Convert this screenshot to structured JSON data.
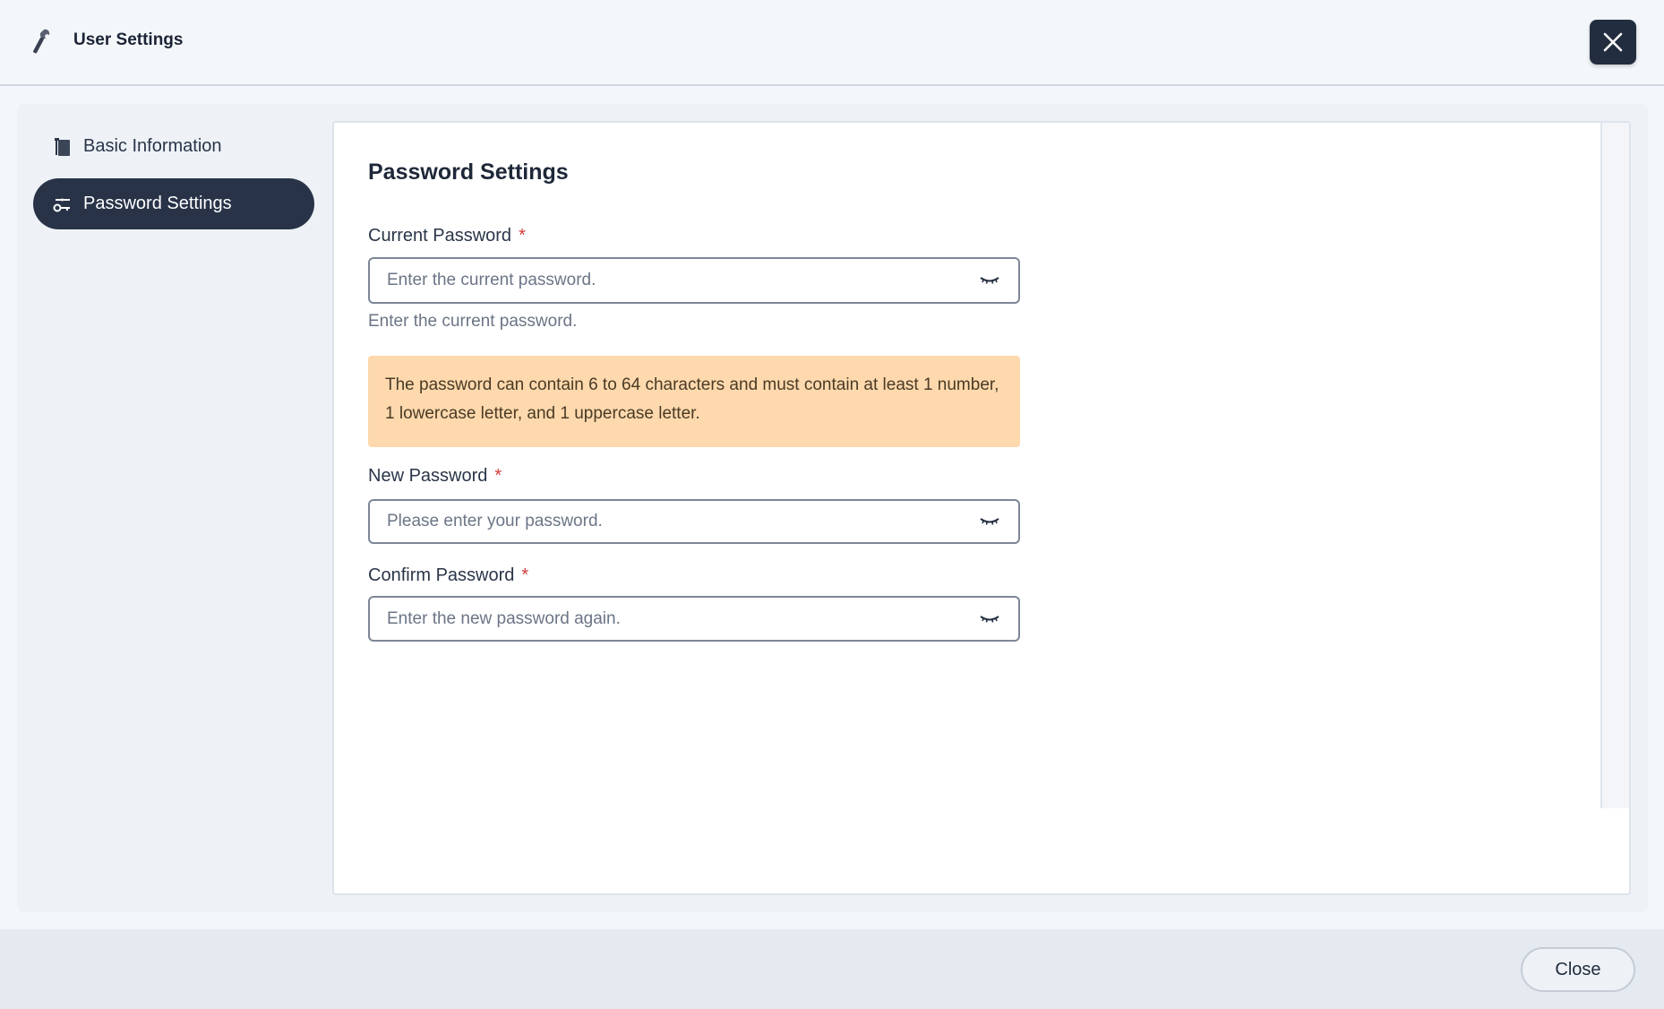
{
  "header": {
    "title": "User Settings",
    "app_icon": "wrench-icon",
    "close_icon": "close-icon"
  },
  "sidebar": {
    "items": [
      {
        "label": "Basic Information",
        "icon": "document-icon",
        "active": false
      },
      {
        "label": "Password Settings",
        "icon": "key-icon",
        "active": true
      }
    ]
  },
  "main": {
    "title": "Password Settings",
    "current_password": {
      "label": "Current Password",
      "required_mark": "*",
      "placeholder": "Enter the current password.",
      "value": "",
      "hint": "Enter the current password."
    },
    "notice": "The password can contain 6 to 64 characters and must contain at least 1 number, 1 lowercase letter, and 1 uppercase letter.",
    "new_password": {
      "label": "New Password",
      "required_mark": "*",
      "placeholder": "Please enter your password.",
      "value": ""
    },
    "confirm_password": {
      "label": "Confirm Password",
      "required_mark": "*",
      "placeholder": "Enter the new password again.",
      "value": ""
    }
  },
  "footer": {
    "close_label": "Close"
  },
  "colors": {
    "active_nav_bg": "#283348",
    "notice_bg": "#fdd9ad",
    "required": "#d33a3a"
  }
}
